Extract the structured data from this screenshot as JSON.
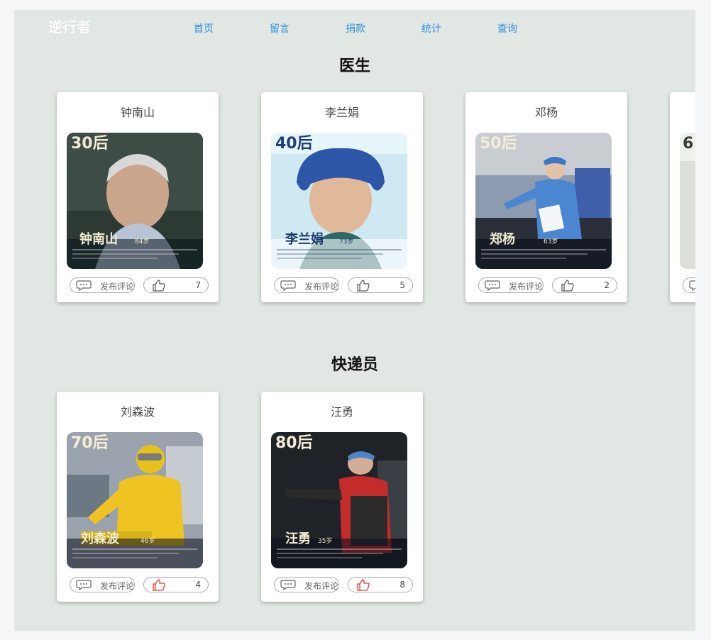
{
  "header": {
    "brand": "逆行者",
    "nav": [
      {
        "label": "首页"
      },
      {
        "label": "留言"
      },
      {
        "label": "捐款"
      },
      {
        "label": "统计"
      },
      {
        "label": "查询"
      }
    ]
  },
  "sections": [
    {
      "title": "医生",
      "cards": [
        {
          "name": "钟南山",
          "badge": "30后",
          "caption_name": "钟南山",
          "caption_age": "84岁",
          "comment_label": "发布评论",
          "likes": "7",
          "liked": false
        },
        {
          "name": "李兰娟",
          "badge": "40后",
          "caption_name": "李兰娟",
          "caption_age": "73岁",
          "comment_label": "发布评论",
          "likes": "5",
          "liked": false
        },
        {
          "name": "邓杨",
          "badge": "50后",
          "caption_name": "郑杨",
          "caption_age": "63岁",
          "comment_label": "发布评论",
          "likes": "2",
          "liked": false
        },
        {
          "name": "",
          "badge": "6",
          "caption_name": "",
          "caption_age": "",
          "comment_label": "",
          "likes": "",
          "liked": false
        }
      ]
    },
    {
      "title": "快递员",
      "cards": [
        {
          "name": "刘森波",
          "badge": "70后",
          "caption_name": "刘森波",
          "caption_age": "46岁",
          "comment_label": "发布评论",
          "likes": "4",
          "liked": true
        },
        {
          "name": "汪勇",
          "badge": "80后",
          "caption_name": "汪勇",
          "caption_age": "35岁",
          "comment_label": "发布评论",
          "likes": "8",
          "liked": true
        }
      ]
    }
  ],
  "colors": {
    "app_background": "#e1e7e3",
    "nav_link": "#2f8fe0",
    "like_active": "#e53935",
    "like_inactive": "#555555"
  },
  "icons": {
    "comment": "comment-bubble-icon",
    "like": "thumbs-up-icon"
  }
}
